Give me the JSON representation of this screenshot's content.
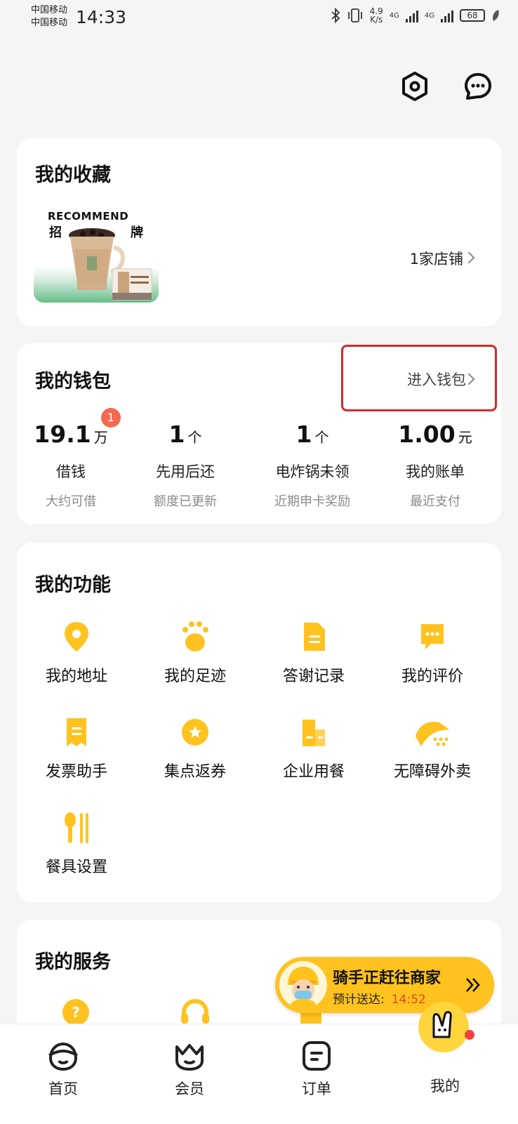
{
  "status_bar": {
    "carrier1": "中国移动",
    "carrier2": "中国移动",
    "time": "14:33",
    "net_speed_value": "4.9",
    "net_speed_unit": "K/s",
    "net1": "4G",
    "net2": "4G",
    "battery": "68"
  },
  "top_icons": [
    "settings-icon",
    "message-icon"
  ],
  "favorites": {
    "title": "我的收藏",
    "image_text": "RECOMMEND",
    "image_char1": "招",
    "image_char2": "牌",
    "count_text": "1家店铺"
  },
  "wallet": {
    "title": "我的钱包",
    "enter_label": "进入钱包",
    "items": [
      {
        "value": "19.1",
        "unit": "万",
        "label": "借钱",
        "sub": "大约可借",
        "badge": "1"
      },
      {
        "value": "1",
        "unit": "个",
        "label": "先用后还",
        "sub": "额度已更新"
      },
      {
        "value": "1",
        "unit": "个",
        "label": "电炸锅未领",
        "sub": "近期申卡奖励"
      },
      {
        "value": "1.00",
        "unit": "元",
        "label": "我的账单",
        "sub": "最近支付"
      }
    ]
  },
  "functions": {
    "title": "我的功能",
    "items": [
      {
        "label": "我的地址",
        "icon": "location-pin-icon"
      },
      {
        "label": "我的足迹",
        "icon": "paw-print-icon"
      },
      {
        "label": "答谢记录",
        "icon": "document-icon"
      },
      {
        "label": "我的评价",
        "icon": "comment-icon"
      },
      {
        "label": "发票助手",
        "icon": "receipt-icon"
      },
      {
        "label": "集点返券",
        "icon": "star-coin-icon"
      },
      {
        "label": "企业用餐",
        "icon": "building-icon"
      },
      {
        "label": "无障碍外卖",
        "icon": "accessible-delivery-icon"
      },
      {
        "label": "餐具设置",
        "icon": "utensils-icon"
      }
    ]
  },
  "services": {
    "title": "我的服务"
  },
  "rider": {
    "title": "骑手正赶往商家",
    "eta_label": "预计送达:",
    "eta_time": "14:52"
  },
  "nav": {
    "items": [
      {
        "label": "首页",
        "icon": "home-face-icon"
      },
      {
        "label": "会员",
        "icon": "crown-face-icon"
      },
      {
        "label": "订单",
        "icon": "order-list-icon"
      },
      {
        "label": "我的",
        "icon": "kangaroo-icon"
      }
    ]
  },
  "colors": {
    "accent_yellow": "#ffc21e",
    "badge_red": "#f26b50",
    "highlight_red": "#d32a2a",
    "eta_red": "#e04a2a"
  }
}
